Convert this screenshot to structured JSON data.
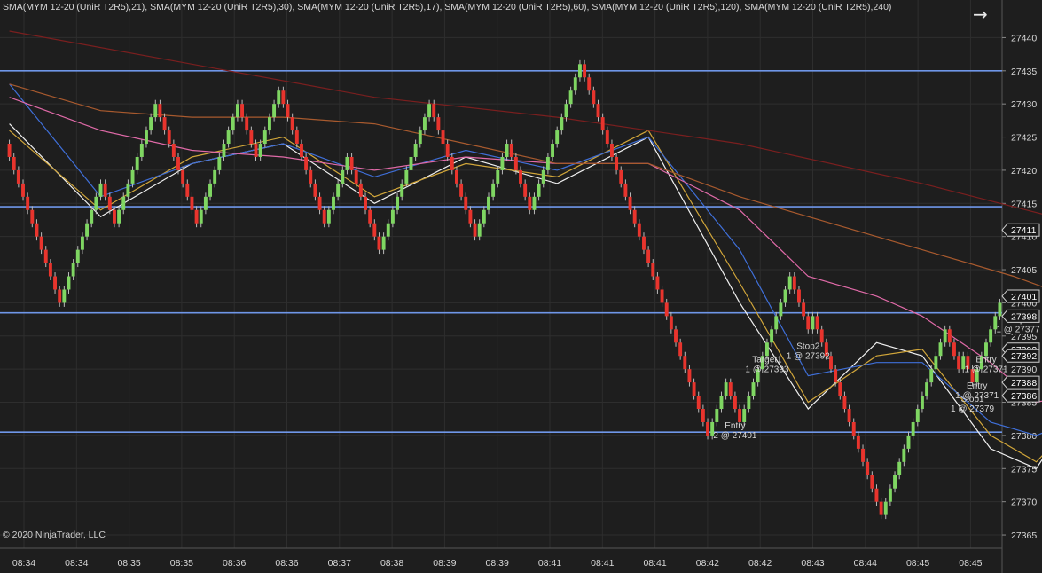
{
  "legend": "SMA(MYM 12-20 (UniR T2R5),21), SMA(MYM 12-20 (UniR T2R5),30), SMA(MYM 12-20 (UniR T2R5),17), SMA(MYM 12-20 (UniR T2R5),60), SMA(MYM 12-20 (UniR T2R5),120), SMA(MYM 12-20 (UniR T2R5),240)",
  "copyright": "© 2020 NinjaTrader, LLC",
  "nav_icon": "arrow-right-icon",
  "colors": {
    "background": "#1e1e1e",
    "grid": "#2e2e2e",
    "up": "#7fd662",
    "down": "#e8342d",
    "hline": "#6f96e8",
    "text": "#d8d8d8"
  },
  "chart_data": {
    "type": "candlestick",
    "instrument": "MYM 12-20 (UniR T2R5)",
    "ylim": [
      27363,
      27443
    ],
    "y_ticks": [
      27365,
      27370,
      27375,
      27380,
      27385,
      27390,
      27395,
      27400,
      27405,
      27410,
      27415,
      27420,
      27425,
      27430,
      27435,
      27440
    ],
    "x_ticks": [
      "08:34",
      "08:34",
      "08:35",
      "08:35",
      "08:36",
      "08:36",
      "08:37",
      "08:38",
      "08:39",
      "08:39",
      "08:41",
      "08:41",
      "08:41",
      "08:42",
      "08:42",
      "08:43",
      "08:44",
      "08:45",
      "08:45"
    ],
    "horizontal_lines": [
      27435,
      27414.5,
      27398.5,
      27380.5
    ],
    "price_markers": [
      27411,
      27401,
      27398,
      27393,
      27392,
      27388,
      27386
    ],
    "closes": [
      27422,
      27420,
      27418,
      27416,
      27414,
      27412,
      27410,
      27408,
      27406,
      27404,
      27402,
      27400,
      27402,
      27404,
      27406,
      27408,
      27410,
      27412,
      27414,
      27416,
      27418,
      27416,
      27414,
      27412,
      27414,
      27416,
      27418,
      27420,
      27422,
      27424,
      27426,
      27428,
      27430,
      27428,
      27426,
      27424,
      27422,
      27420,
      27418,
      27416,
      27414,
      27412,
      27414,
      27416,
      27418,
      27420,
      27422,
      27424,
      27426,
      27428,
      27430,
      27428,
      27426,
      27424,
      27422,
      27424,
      27426,
      27428,
      27430,
      27432,
      27430,
      27428,
      27426,
      27424,
      27422,
      27420,
      27418,
      27416,
      27414,
      27412,
      27414,
      27416,
      27418,
      27420,
      27422,
      27420,
      27418,
      27416,
      27414,
      27412,
      27410,
      27408,
      27410,
      27412,
      27414,
      27416,
      27418,
      27420,
      27422,
      27424,
      27426,
      27428,
      27430,
      27428,
      27426,
      27424,
      27422,
      27420,
      27418,
      27416,
      27414,
      27412,
      27410,
      27412,
      27414,
      27416,
      27418,
      27420,
      27422,
      27424,
      27422,
      27420,
      27418,
      27416,
      27414,
      27416,
      27418,
      27420,
      27422,
      27424,
      27426,
      27428,
      27430,
      27432,
      27434,
      27436,
      27434,
      27432,
      27430,
      27428,
      27426,
      27424,
      27422,
      27420,
      27418,
      27416,
      27414,
      27412,
      27410,
      27408,
      27406,
      27404,
      27402,
      27400,
      27398,
      27396,
      27394,
      27392,
      27390,
      27388,
      27386,
      27384,
      27382,
      27380,
      27382,
      27384,
      27386,
      27388,
      27386,
      27384,
      27382,
      27384,
      27386,
      27388,
      27390,
      27392,
      27394,
      27396,
      27398,
      27400,
      27402,
      27404,
      27402,
      27400,
      27398,
      27396,
      27398,
      27396,
      27394,
      27392,
      27390,
      27388,
      27386,
      27384,
      27382,
      27380,
      27378,
      27376,
      27374,
      27372,
      27370,
      27368,
      27370,
      27372,
      27374,
      27376,
      27378,
      27380,
      27382,
      27384,
      27386,
      27388,
      27390,
      27392,
      27394,
      27396,
      27394,
      27392,
      27390,
      27392,
      27390,
      27388,
      27390,
      27392,
      27394,
      27396,
      27398,
      27400
    ],
    "sma_lines": [
      {
        "period": 17,
        "color": "#f0f0f0",
        "points": [
          [
            0,
            27427
          ],
          [
            20,
            27413
          ],
          [
            40,
            27421
          ],
          [
            60,
            27424
          ],
          [
            80,
            27415
          ],
          [
            100,
            27422
          ],
          [
            120,
            27418
          ],
          [
            140,
            27425
          ],
          [
            160,
            27400
          ],
          [
            175,
            27384
          ],
          [
            190,
            27394
          ],
          [
            200,
            27392
          ],
          [
            215,
            27378
          ],
          [
            225,
            27375
          ],
          [
            240,
            27391
          ]
        ]
      },
      {
        "period": 21,
        "color": "#d1a63a",
        "points": [
          [
            0,
            27426
          ],
          [
            20,
            27414
          ],
          [
            40,
            27422
          ],
          [
            60,
            27425
          ],
          [
            80,
            27416
          ],
          [
            100,
            27421
          ],
          [
            120,
            27419
          ],
          [
            140,
            27426
          ],
          [
            160,
            27403
          ],
          [
            175,
            27385
          ],
          [
            190,
            27392
          ],
          [
            200,
            27393
          ],
          [
            215,
            27380
          ],
          [
            225,
            27376
          ],
          [
            240,
            27387
          ]
        ]
      },
      {
        "period": 30,
        "color": "#3f6fd8",
        "points": [
          [
            0,
            27433
          ],
          [
            20,
            27416
          ],
          [
            40,
            27421
          ],
          [
            60,
            27424
          ],
          [
            80,
            27419
          ],
          [
            100,
            27423
          ],
          [
            120,
            27420
          ],
          [
            140,
            27425
          ],
          [
            160,
            27408
          ],
          [
            175,
            27389
          ],
          [
            190,
            27391
          ],
          [
            200,
            27391
          ],
          [
            215,
            27382
          ],
          [
            225,
            27380
          ],
          [
            240,
            27384
          ]
        ]
      },
      {
        "period": 60,
        "color": "#e06aa8",
        "points": [
          [
            0,
            27431
          ],
          [
            20,
            27426
          ],
          [
            40,
            27423
          ],
          [
            60,
            27422
          ],
          [
            80,
            27420
          ],
          [
            100,
            27422
          ],
          [
            120,
            27421
          ],
          [
            140,
            27421
          ],
          [
            160,
            27414
          ],
          [
            175,
            27404
          ],
          [
            190,
            27401
          ],
          [
            200,
            27398
          ],
          [
            215,
            27391
          ],
          [
            225,
            27385
          ],
          [
            240,
            27387
          ]
        ]
      },
      {
        "period": 120,
        "color": "#a85a2e",
        "points": [
          [
            0,
            27433
          ],
          [
            20,
            27429
          ],
          [
            40,
            27428
          ],
          [
            60,
            27428
          ],
          [
            80,
            27427
          ],
          [
            100,
            27424
          ],
          [
            120,
            27421
          ],
          [
            140,
            27421
          ],
          [
            160,
            27416
          ],
          [
            180,
            27412
          ],
          [
            200,
            27408
          ],
          [
            220,
            27404
          ],
          [
            240,
            27399
          ]
        ]
      },
      {
        "period": 240,
        "color": "#7a1f1f",
        "points": [
          [
            0,
            27441
          ],
          [
            40,
            27436
          ],
          [
            80,
            27431
          ],
          [
            120,
            27428
          ],
          [
            160,
            27424
          ],
          [
            200,
            27418
          ],
          [
            240,
            27411
          ]
        ]
      }
    ],
    "annotations": [
      {
        "text1": "Entry",
        "text2": "2 @ 27401",
        "bar": 159
      },
      {
        "text1": "Target1",
        "text2": "1 @ 27393",
        "bar": 166
      },
      {
        "text1": "Stop2",
        "text2": "1 @ 27392",
        "bar": 175
      },
      {
        "text1": "Entry",
        "text2": "1 @ 27371",
        "bar": 212
      },
      {
        "text1": "Entry",
        "text2": "1 @ 27371",
        "bar": 214
      },
      {
        "text1": "Stop1",
        "text2": "1 @ 27379",
        "bar": 211
      },
      {
        "text1": "Stop2",
        "text2": "1 @ 27377",
        "bar": 221
      }
    ]
  }
}
